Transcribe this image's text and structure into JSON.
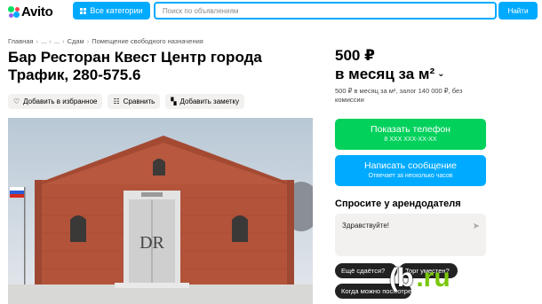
{
  "header": {
    "logo": "Avito",
    "categories_label": "Все категории",
    "search_placeholder": "Поиск по объявлениям",
    "search_button": "Найти"
  },
  "breadcrumbs": [
    "Главная",
    "...",
    "...",
    "Сдам",
    "Помещение свободного назначения"
  ],
  "listing": {
    "title": "Бар Ресторан Квест Центр города Трафик, 280-575.6",
    "actions": {
      "favorite": "Добавить в избранное",
      "compare": "Сравнить",
      "note": "Добавить заметку"
    },
    "sign_letters": "DR"
  },
  "price": {
    "amount": "500 ₽",
    "period": "в месяц за м²",
    "note": "500 ₽ в месяц за м², залог 140 000 ₽, без комиссии"
  },
  "contact": {
    "phone_label": "Показать телефон",
    "phone_masked": "8 XXX XXX-XX-XX",
    "message_label": "Написать сообщение",
    "message_sub": "Отвечает за несколько часов"
  },
  "ask": {
    "title": "Спросите у арендодателя",
    "input_value": "Здравствуйте!",
    "chips": [
      "Ещё сдаётся?",
      "Торг уместен?",
      "Когда можно посмотреть?"
    ]
  },
  "watermark": {
    "main": "(b",
    "suffix": ".ru"
  },
  "colors": {
    "brand_blue": "#00aaff",
    "phone_green": "#02d15c",
    "watermark_green": "#7ac70c"
  }
}
